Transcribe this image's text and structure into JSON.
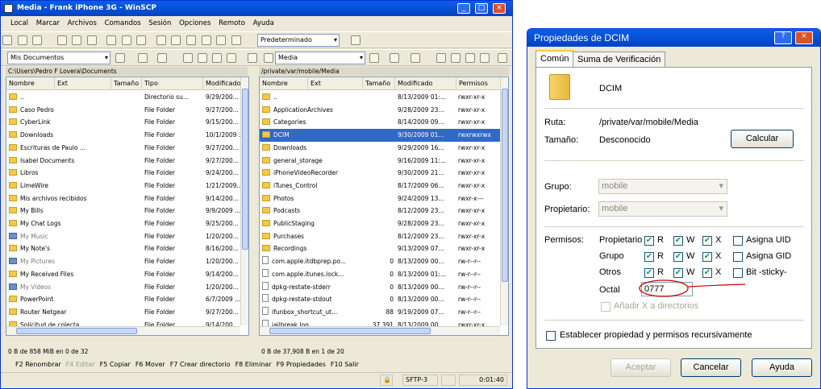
{
  "winscp": {
    "title": "Media - Frank iPhone 3G - WinSCP",
    "menu": [
      "Local",
      "Marcar",
      "Archivos",
      "Comandos",
      "Sesión",
      "Opciones",
      "Remoto",
      "Ayuda"
    ],
    "toolbar_preset": "Predeterminado",
    "left_drive": "Mis Documentos",
    "right_drive": "Media",
    "left_path": "C:\\Users\\Pedro F Lovera\\Documents",
    "right_path": "/private/var/mobile/Media",
    "left_headers": {
      "name": "Nombre",
      "ext": "Ext",
      "size": "Tamaño",
      "type": "Tipo",
      "modified": "Modificado"
    },
    "right_headers": {
      "name": "Nombre",
      "ext": "Ext",
      "size": "Tamaño",
      "modified": "Modificado",
      "perms": "Permisos"
    },
    "left_files": [
      {
        "name": "..",
        "type": "Directorio su...",
        "modified": "9/29/200...",
        "kind": "up"
      },
      {
        "name": "Caso Pedro",
        "type": "File Folder",
        "modified": "9/27/200...",
        "kind": "folder"
      },
      {
        "name": "CyberLink",
        "type": "File Folder",
        "modified": "9/15/200...",
        "kind": "folder"
      },
      {
        "name": "Downloads",
        "type": "File Folder",
        "modified": "10/1/2009 ...",
        "kind": "folder"
      },
      {
        "name": "Escrituras de Paulo ...",
        "type": "File Folder",
        "modified": "9/27/200...",
        "kind": "folder"
      },
      {
        "name": "Isabel Documents",
        "type": "File Folder",
        "modified": "9/27/200...",
        "kind": "folder"
      },
      {
        "name": "Libros",
        "type": "File Folder",
        "modified": "9/24/200...",
        "kind": "folder"
      },
      {
        "name": "LimeWire",
        "type": "File Folder",
        "modified": "1/21/2009...",
        "kind": "folder"
      },
      {
        "name": "Mis archivos recibidos",
        "type": "File Folder",
        "modified": "9/14/200...",
        "kind": "folder"
      },
      {
        "name": "My Bills",
        "type": "File Folder",
        "modified": "9/9/2009 ...",
        "kind": "folder"
      },
      {
        "name": "My Chat Logs",
        "type": "File Folder",
        "modified": "9/25/200...",
        "kind": "folder"
      },
      {
        "name": "My Music",
        "type": "File Folder",
        "modified": "1/20/200...",
        "kind": "sys"
      },
      {
        "name": "My Note's",
        "type": "File Folder",
        "modified": "8/16/200...",
        "kind": "folder"
      },
      {
        "name": "My Pictures",
        "type": "File Folder",
        "modified": "1/20/200...",
        "kind": "sys"
      },
      {
        "name": "My Received Files",
        "type": "File Folder",
        "modified": "9/14/200...",
        "kind": "folder"
      },
      {
        "name": "My Videos",
        "type": "File Folder",
        "modified": "1/20/200...",
        "kind": "sys"
      },
      {
        "name": "PowerPoint",
        "type": "File Folder",
        "modified": "6/7/2009 ...",
        "kind": "folder"
      },
      {
        "name": "Router Netgear",
        "type": "File Folder",
        "modified": "9/27/200...",
        "kind": "folder"
      },
      {
        "name": "Solicitud de colecta ...",
        "type": "File Folder",
        "modified": "9/14/200...",
        "kind": "folder"
      }
    ],
    "right_files": [
      {
        "name": "..",
        "size": "",
        "modified": "8/13/2009 01:...",
        "perms": "rwxr-xr-x",
        "kind": "up"
      },
      {
        "name": "ApplicationArchives",
        "size": "",
        "modified": "9/28/2009 23...",
        "perms": "rwxr-xr-x",
        "kind": "folder"
      },
      {
        "name": "Categories",
        "size": "",
        "modified": "8/14/2009 09...",
        "perms": "rwxr-xr-x",
        "kind": "folder"
      },
      {
        "name": "DCIM",
        "size": "",
        "modified": "9/30/2009 01...",
        "perms": "rwxrwxrwx",
        "kind": "folder",
        "selected": true
      },
      {
        "name": "Downloads",
        "size": "",
        "modified": "9/29/2009 16...",
        "perms": "rwxr-xr-x",
        "kind": "folder"
      },
      {
        "name": "general_storage",
        "size": "",
        "modified": "9/16/2009 11:...",
        "perms": "rwxr-xr-x",
        "kind": "folder"
      },
      {
        "name": "iPhoneVideoRecorder",
        "size": "",
        "modified": "9/30/2009 21...",
        "perms": "rwxr-xr-x",
        "kind": "folder"
      },
      {
        "name": "iTunes_Control",
        "size": "",
        "modified": "8/17/2009 06...",
        "perms": "rwxr-xr-x",
        "kind": "folder"
      },
      {
        "name": "Photos",
        "size": "",
        "modified": "9/24/2009 13...",
        "perms": "rwxr-x---",
        "kind": "folder"
      },
      {
        "name": "Podcasts",
        "size": "",
        "modified": "8/12/2009 23...",
        "perms": "rwxr-xr-x",
        "kind": "folder"
      },
      {
        "name": "PublicStaging",
        "size": "",
        "modified": "9/28/2009 23...",
        "perms": "rwxr-xr-x",
        "kind": "folder"
      },
      {
        "name": "Purchases",
        "size": "",
        "modified": "8/12/2009 23...",
        "perms": "rwxr-xr-x",
        "kind": "folder"
      },
      {
        "name": "Recordings",
        "size": "",
        "modified": "9/13/2009 07...",
        "perms": "rwxr-xr-x",
        "kind": "folder"
      },
      {
        "name": "com.apple.itdbprep.po...",
        "size": "0",
        "modified": "8/13/2009 00...",
        "perms": "rw-r--r--",
        "kind": "doc"
      },
      {
        "name": "com.apple.itunes.lock...",
        "size": "0",
        "modified": "8/13/2009 01:...",
        "perms": "rw-r--r--",
        "kind": "doc"
      },
      {
        "name": "dpkg-restate-stderr",
        "size": "0",
        "modified": "8/13/2009 00...",
        "perms": "rw-r--r--",
        "kind": "doc"
      },
      {
        "name": "dpkg-restate-stdout",
        "size": "0",
        "modified": "8/13/2009 00...",
        "perms": "rw-r--r--",
        "kind": "doc"
      },
      {
        "name": "ifunbox_shortcut_ut...",
        "size": "88",
        "modified": "9/19/2009 07...",
        "perms": "rw-r--r--",
        "kind": "doc"
      },
      {
        "name": "jailbreak.log",
        "size": "37,391",
        "modified": "8/13/2009 00...",
        "perms": "rwxr-xr-x",
        "kind": "doc"
      }
    ],
    "left_status": "0 B de 858 MiB en 0 de 32",
    "right_status": "0 B de 37,908 B en 1 de 20",
    "fkeys": [
      {
        "label": "F2 Renombrar",
        "disabled": false
      },
      {
        "label": "F4 Editar",
        "disabled": true
      },
      {
        "label": "F5 Copiar",
        "disabled": false
      },
      {
        "label": "F6 Mover",
        "disabled": false
      },
      {
        "label": "F7 Crear directorio",
        "disabled": false
      },
      {
        "label": "F8 Eliminar",
        "disabled": false
      },
      {
        "label": "F9 Propiedades",
        "disabled": false
      },
      {
        "label": "F10 Salir",
        "disabled": false
      }
    ],
    "protocol": "SFTP-3",
    "elapsed": "0:01:40"
  },
  "dialog": {
    "title": "Propiedades de DCIM",
    "tabs": [
      "Común",
      "Suma de Verificación"
    ],
    "name": "DCIM",
    "ruta_label": "Ruta:",
    "ruta_value": "/private/var/mobile/Media",
    "tamano_label": "Tamaño:",
    "tamano_value": "Desconocido",
    "calcular": "Calcular",
    "grupo_label": "Grupo:",
    "grupo_value": "mobile",
    "propietario_label": "Propietario:",
    "propietario_value": "mobile",
    "permisos_label": "Permisos:",
    "perm_rows": [
      {
        "label": "Propietario",
        "r": true,
        "w": true,
        "x": true,
        "extra": "Asigna UID"
      },
      {
        "label": "Grupo",
        "r": true,
        "w": true,
        "x": true,
        "extra": "Asigna GID"
      },
      {
        "label": "Otros",
        "r": true,
        "w": true,
        "x": true,
        "extra": "Bit -sticky-"
      }
    ],
    "r_label": "R",
    "w_label": "W",
    "x_label": "X",
    "octal_label": "Octal",
    "octal_value": "0777",
    "add_x": "Añadir X a directorios",
    "recursive": "Establecer propiedad y permisos recursivamente",
    "btn_accept": "Aceptar",
    "btn_cancel": "Cancelar",
    "btn_help": "Ayuda"
  }
}
